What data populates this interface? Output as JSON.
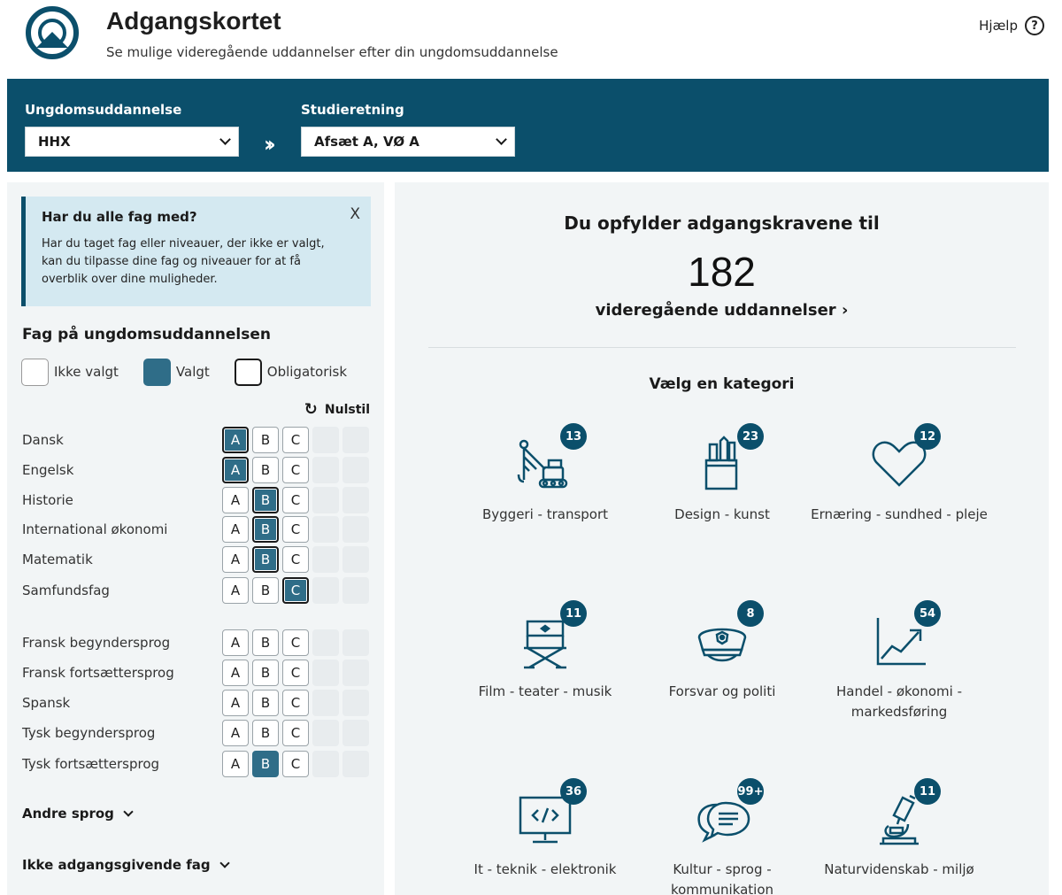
{
  "header": {
    "title": "Adgangskortet",
    "subtitle": "Se mulige videregående uddannelser efter din ungdomsuddannelse",
    "help_label": "Hjælp"
  },
  "filters": {
    "ungdom_label": "Ungdomsuddannelse",
    "ungdom_value": "HHX",
    "studie_label": "Studieretning",
    "studie_value": "Afsæt A, VØ A"
  },
  "info_box": {
    "title": "Har du alle fag med?",
    "text": "Har du taget fag eller niveauer, der ikke er valgt, kan du tilpasse dine fag og niveauer for at få overblik over dine muligheder.",
    "close": "X"
  },
  "subjects": {
    "heading": "Fag på ungdomsuddannelsen",
    "legend": {
      "not_selected": "Ikke valgt",
      "selected": "Valgt",
      "mandatory": "Obligatorisk"
    },
    "reset_label": "Nulstil",
    "levels": [
      "A",
      "B",
      "C"
    ],
    "rows": [
      {
        "name": "Dansk",
        "selected": "A",
        "mandatory": true
      },
      {
        "name": "Engelsk",
        "selected": "A",
        "mandatory": true
      },
      {
        "name": "Historie",
        "selected": "B",
        "mandatory": true
      },
      {
        "name": "International økonomi",
        "selected": "B",
        "mandatory": true
      },
      {
        "name": "Matematik",
        "selected": "B",
        "mandatory": true
      },
      {
        "name": "Samfundsfag",
        "selected": "C",
        "mandatory": true
      },
      {
        "name": "Fransk begyndersprog",
        "selected": null,
        "mandatory": false
      },
      {
        "name": "Fransk fortsættersprog",
        "selected": null,
        "mandatory": false
      },
      {
        "name": "Spansk",
        "selected": null,
        "mandatory": false
      },
      {
        "name": "Tysk begyndersprog",
        "selected": null,
        "mandatory": false
      },
      {
        "name": "Tysk fortsættersprog",
        "selected": "B",
        "mandatory": false
      }
    ],
    "andre_sprog": "Andre sprog",
    "ikke_adgangsgivende": "Ikke adgangsgivende fag"
  },
  "results": {
    "title": "Du opfylder adgangskravene til",
    "count": "182",
    "link_label": "videregående uddannelser",
    "category_heading": "Vælg en kategori"
  },
  "categories": [
    {
      "label": "Byggeri - transport",
      "count": "13",
      "icon": "crane-icon"
    },
    {
      "label": "Design - kunst",
      "count": "23",
      "icon": "pencil-cup-icon"
    },
    {
      "label": "Ernæring - sundhed - pleje",
      "count": "12",
      "icon": "heart-icon"
    },
    {
      "label": "Film - teater - musik",
      "count": "11",
      "icon": "director-chair-icon"
    },
    {
      "label": "Forsvar og politi",
      "count": "8",
      "icon": "police-cap-icon"
    },
    {
      "label": "Handel - økonomi - markedsføring",
      "count": "54",
      "icon": "trend-chart-icon"
    },
    {
      "label": "It - teknik - elektronik",
      "count": "36",
      "icon": "monitor-code-icon"
    },
    {
      "label": "Kultur - sprog - kommunikation",
      "count": "99+",
      "icon": "speech-bubbles-icon"
    },
    {
      "label": "Naturvidenskab - miljø",
      "count": "11",
      "icon": "microscope-icon"
    }
  ],
  "colors": {
    "primary": "#0b4f6b",
    "selected": "#2f6d88",
    "panel": "#f2f5f6",
    "info": "#d4e9f1"
  }
}
